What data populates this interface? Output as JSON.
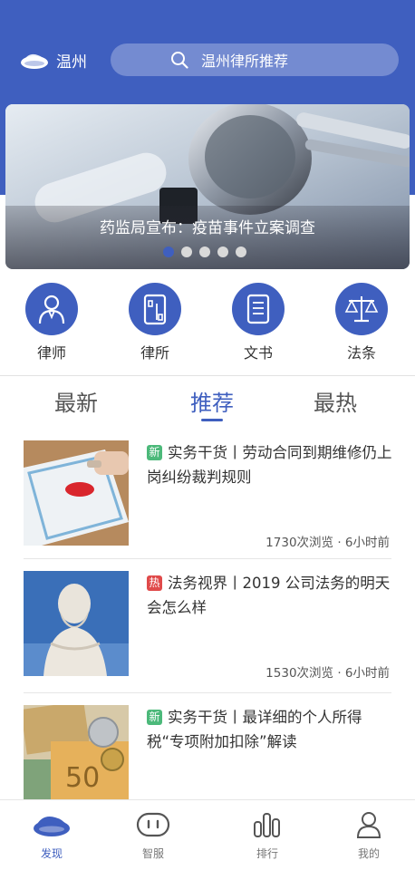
{
  "header": {
    "city": "温州",
    "search_placeholder": "温州律所推荐"
  },
  "banner": {
    "caption": "药监局宣布：疫苗事件立案调查",
    "dots_total": 5,
    "dots_active": 1
  },
  "categories": [
    {
      "label": "律师",
      "icon": "lawyer-icon"
    },
    {
      "label": "律所",
      "icon": "law-firm-icon"
    },
    {
      "label": "文书",
      "icon": "document-icon"
    },
    {
      "label": "法条",
      "icon": "scales-icon"
    }
  ],
  "tabs": [
    {
      "label": "最新",
      "active": false
    },
    {
      "label": "推荐",
      "active": true
    },
    {
      "label": "最热",
      "active": false
    }
  ],
  "articles": [
    {
      "tag": "新",
      "tag_color": "#4cb97a",
      "title": "实务干货丨劳动合同到期维修仍上岗纠纷裁判规则",
      "meta": "1730次浏览 · 6小时前"
    },
    {
      "tag": "热",
      "tag_color": "#e04a4a",
      "title": "法务视界丨2019 公司法务的明天会怎么样",
      "meta": "1530次浏览 · 6小时前"
    },
    {
      "tag": "新",
      "tag_color": "#4cb97a",
      "title": "实务干货丨最详细的个人所得税“专项附加扣除”解读",
      "meta": ""
    }
  ],
  "bottom_nav": [
    {
      "label": "发现",
      "icon": "discover-icon",
      "active": true
    },
    {
      "label": "智服",
      "icon": "robot-icon",
      "active": false
    },
    {
      "label": "排行",
      "icon": "ranking-icon",
      "active": false
    },
    {
      "label": "我的",
      "icon": "profile-icon",
      "active": false
    }
  ],
  "colors": {
    "brand": "#3f5fbf",
    "tag_new": "#4cb97a",
    "tag_hot": "#e04a4a"
  }
}
